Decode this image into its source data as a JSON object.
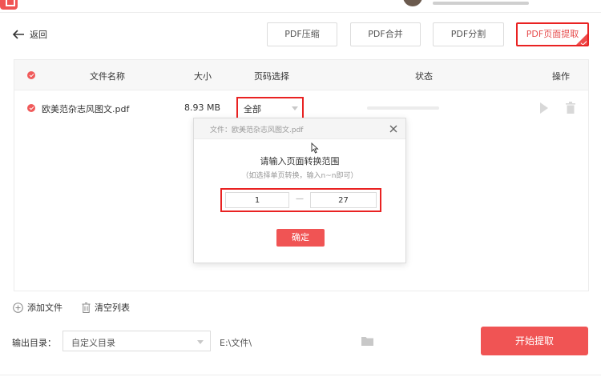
{
  "nav": {
    "back_label": "返回"
  },
  "tools": [
    {
      "label": "PDF压缩",
      "active": false
    },
    {
      "label": "PDF合并",
      "active": false
    },
    {
      "label": "PDF分割",
      "active": false
    },
    {
      "label": "PDF页面提取",
      "active": true
    }
  ],
  "table": {
    "headers": {
      "name": "文件名称",
      "size": "大小",
      "pages": "页码选择",
      "status": "状态",
      "actions": "操作"
    },
    "rows": [
      {
        "name": "欧美范杂志风图文.pdf",
        "size": "8.93 MB",
        "pages": "全部",
        "progress": 0
      }
    ]
  },
  "dialog": {
    "file_label": "文件：欧美范杂志风图文.pdf",
    "title": "请输入页面转换范围",
    "hint": "（如选择单页转换，输入n~n即可）",
    "range_from": "1",
    "range_separator": "—",
    "range_to": "27",
    "confirm_label": "确定"
  },
  "list_actions": {
    "add_label": "添加文件",
    "clear_label": "清空列表"
  },
  "output": {
    "label": "输出目录：",
    "select_value": "自定义目录",
    "path": "E:\\文件\\"
  },
  "start_label": "开始提取",
  "colors": {
    "accent": "#f05454",
    "highlight": "#e92222"
  }
}
